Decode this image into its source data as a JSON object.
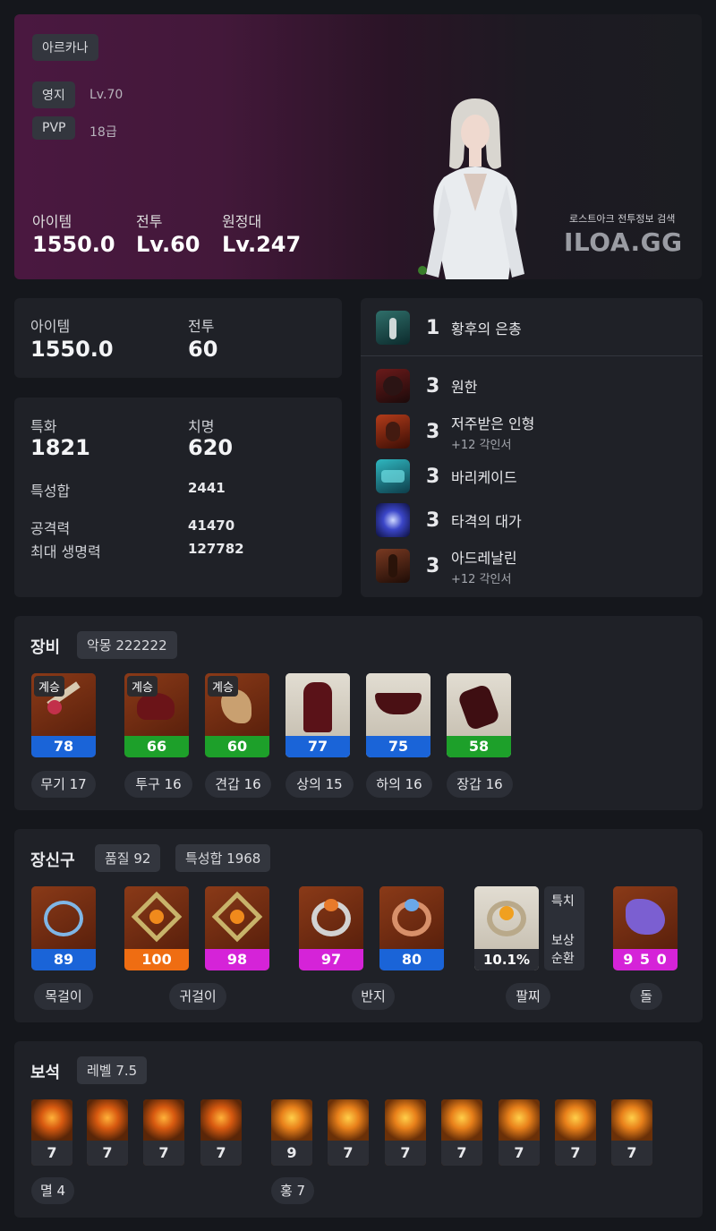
{
  "hero": {
    "server": "아르카나",
    "estate_label": "영지",
    "estate_value": "Lv.70",
    "pvp_label": "PVP",
    "pvp_value": "18급",
    "item_label": "아이템",
    "item_value": "1550.0",
    "combat_label": "전투",
    "combat_value": "Lv.60",
    "expedition_label": "원정대",
    "expedition_value": "Lv.247",
    "brand_sub": "로스트아크 전투정보 검색",
    "brand": "ILOA.GG"
  },
  "level_card": {
    "item_label": "아이템",
    "item_value": "1550.0",
    "combat_label": "전투",
    "combat_value": "60"
  },
  "stats": {
    "spec_label": "특화",
    "spec_value": "1821",
    "crit_label": "치명",
    "crit_value": "620",
    "total_label": "특성합",
    "total_value": "2441",
    "atk_label": "공격력",
    "atk_value": "41470",
    "hp_label": "최대 생명력",
    "hp_value": "127782"
  },
  "engravings": [
    {
      "level": "1",
      "name": "황후의 은총",
      "sub": "",
      "icon": "empress-grace-icon"
    },
    {
      "level": "3",
      "name": "원한",
      "sub": "",
      "icon": "grudge-icon"
    },
    {
      "level": "3",
      "name": "저주받은 인형",
      "sub": "+12 각인서",
      "icon": "cursed-doll-icon"
    },
    {
      "level": "3",
      "name": "바리케이드",
      "sub": "",
      "icon": "barricade-icon"
    },
    {
      "level": "3",
      "name": "타격의 대가",
      "sub": "",
      "icon": "hit-master-icon"
    },
    {
      "level": "3",
      "name": "아드레날린",
      "sub": "+12 각인서",
      "icon": "adrenaline-icon"
    }
  ],
  "equipment": {
    "title": "장비",
    "set_badge": "악몽 222222",
    "items": [
      {
        "quality": "78",
        "tag": "계승",
        "label": "무기 17",
        "color": "#1a64d8",
        "icon": "weapon-icon"
      },
      {
        "quality": "66",
        "tag": "계승",
        "label": "투구 16",
        "color": "#1da02a",
        "icon": "helmet-icon"
      },
      {
        "quality": "60",
        "tag": "계승",
        "label": "견갑 16",
        "color": "#1da02a",
        "icon": "shoulder-icon"
      },
      {
        "quality": "77",
        "tag": "",
        "label": "상의 15",
        "color": "#1a64d8",
        "icon": "chest-icon"
      },
      {
        "quality": "75",
        "tag": "",
        "label": "하의 16",
        "color": "#1a64d8",
        "icon": "pants-icon"
      },
      {
        "quality": "58",
        "tag": "",
        "label": "장갑 16",
        "color": "#1da02a",
        "icon": "gloves-icon"
      }
    ]
  },
  "accessories": {
    "title": "장신구",
    "quality_badge": "품질 92",
    "stat_badge": "특성합 1968",
    "items": [
      {
        "value": "89",
        "color": "#1a64d8",
        "icon": "necklace-icon"
      },
      {
        "value": "100",
        "color": "#ef6d12",
        "icon": "earring-icon"
      },
      {
        "value": "98",
        "color": "#d523d8",
        "icon": "earring-icon"
      },
      {
        "value": "97",
        "color": "#d523d8",
        "icon": "ring-icon"
      },
      {
        "value": "80",
        "color": "#1a64d8",
        "icon": "ring-icon"
      },
      {
        "value": "10.1%",
        "color": "#2a2c33",
        "icon": "bracelet-icon"
      },
      {
        "value": "9 5 0",
        "color": "#d523d8",
        "icon": "stone-icon"
      }
    ],
    "bracelet_stat": "특치",
    "bracelet_effect_1": "보상",
    "bracelet_effect_2": "순환",
    "labels": [
      "목걸이",
      "귀걸이",
      "반지",
      "팔찌",
      "돌"
    ]
  },
  "gems": {
    "title": "보석",
    "level_badge": "레벨 7.5",
    "annihilation": [
      "7",
      "7",
      "7",
      "7"
    ],
    "crimson": [
      "9",
      "7",
      "7",
      "7",
      "7",
      "7",
      "7"
    ],
    "annihilation_label": "멸 4",
    "crimson_label": "홍 7"
  }
}
